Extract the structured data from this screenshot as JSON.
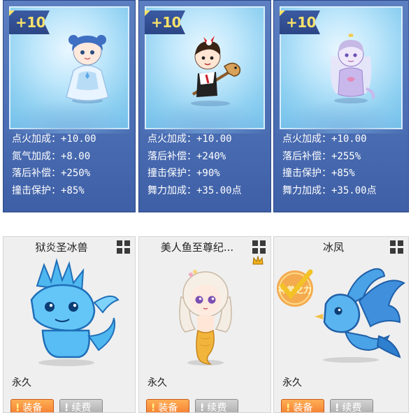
{
  "boost_cards": [
    {
      "badge": "+10",
      "character_icon": "blue-haired-fairy-girl",
      "stats": [
        {
          "label": "点火加成：",
          "value": "+10.00"
        },
        {
          "label": "氮气加成：",
          "value": "+8.00"
        },
        {
          "label": "落后补偿：",
          "value": "+250%"
        },
        {
          "label": "撞击保护：",
          "value": "+85%"
        }
      ]
    },
    {
      "badge": "+10",
      "character_icon": "boy-on-hobby-horse",
      "stats": [
        {
          "label": "点火加成：",
          "value": "+10.00"
        },
        {
          "label": "落后补偿：",
          "value": "+240%"
        },
        {
          "label": "撞击保护：",
          "value": "+90%"
        },
        {
          "label": "舞力加成：",
          "value": "+35.00点"
        }
      ]
    },
    {
      "badge": "+10",
      "character_icon": "lavender-ghost-girl",
      "stats": [
        {
          "label": "点火加成：",
          "value": "+10.00"
        },
        {
          "label": "落后补偿：",
          "value": "+255%"
        },
        {
          "label": "撞击保护：",
          "value": "+85%"
        },
        {
          "label": "舞力加成：",
          "value": "+35.00点"
        }
      ]
    }
  ],
  "pets": [
    {
      "name": "狱炎圣冰兽",
      "duration": "永久",
      "equip_label": "装备",
      "renew_label": "续费",
      "icon": "ice-dragon-icon",
      "has_crown": false,
      "stamp": ""
    },
    {
      "name": "美人鱼至尊纪...",
      "duration": "永久",
      "equip_label": "装备",
      "renew_label": "续费",
      "icon": "mermaid-icon",
      "has_crown": true,
      "stamp": ""
    },
    {
      "name": "冰凤",
      "duration": "永久",
      "equip_label": "装备",
      "renew_label": "续费",
      "icon": "ice-phoenix-icon",
      "has_crown": false,
      "stamp": "神兽之力"
    }
  ],
  "colors": {
    "badge_text": "#f7e36b",
    "card_bg": "#4f72b7",
    "equip_button": "#f2772b",
    "renew_button": "#a8a8a8"
  }
}
